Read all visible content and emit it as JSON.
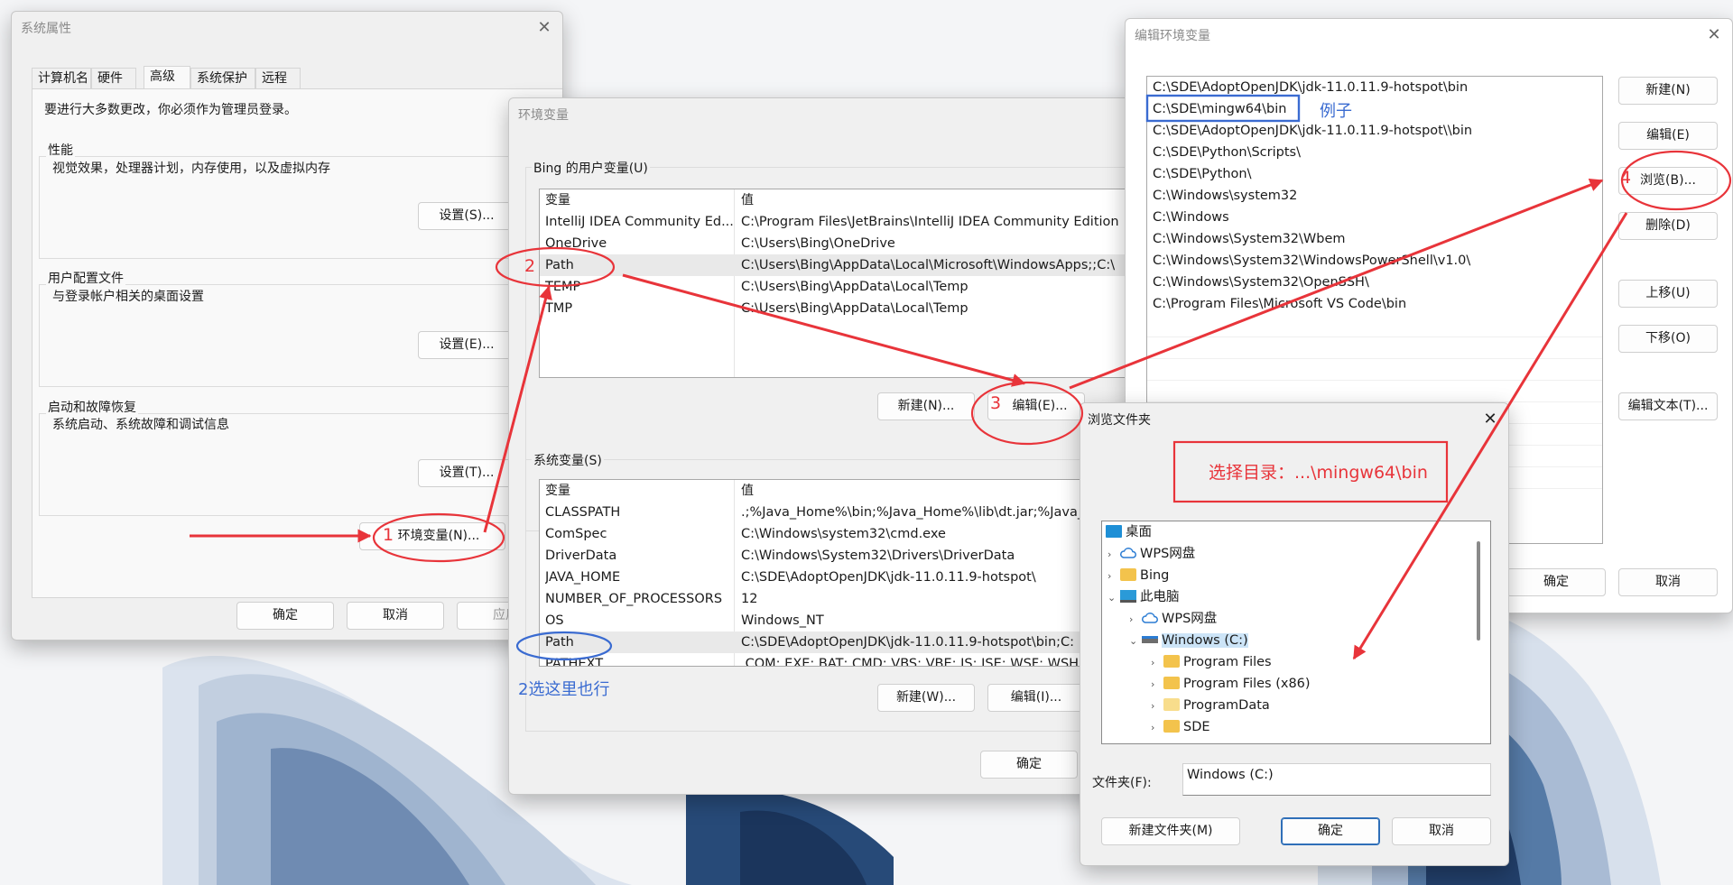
{
  "colors": {
    "annotation_red": "#e8343a",
    "annotation_blue": "#3a6bd1",
    "selection": "#cce4f7",
    "wallpaper_dark": "#1f3a5c"
  },
  "system_properties": {
    "title": "系统属性",
    "tabs": [
      "计算机名",
      "硬件",
      "高级",
      "系统保护",
      "远程"
    ],
    "admin_note": "要进行大多数更改，你必须作为管理员登录。",
    "performance": {
      "label": "性能",
      "description": "视觉效果，处理器计划，内存使用，以及虚拟内存",
      "button": "设置(S)..."
    },
    "profiles": {
      "label": "用户配置文件",
      "description": "与登录帐户相关的桌面设置",
      "button": "设置(E)..."
    },
    "startup": {
      "label": "启动和故障恢复",
      "description": "系统启动、系统故障和调试信息",
      "button": "设置(T)..."
    },
    "env_button": "环境变量(N)...",
    "ok": "确定",
    "cancel": "取消",
    "apply": "应用"
  },
  "env_vars": {
    "title": "环境变量",
    "user_group_label": "Bing 的用户变量(U)",
    "col_var": "变量",
    "col_val": "值",
    "user_rows": [
      {
        "name": "IntelliJ IDEA Community Ed...",
        "value": "C:\\Program Files\\JetBrains\\IntelliJ IDEA Community Edition"
      },
      {
        "name": "OneDrive",
        "value": "C:\\Users\\Bing\\OneDrive"
      },
      {
        "name": "Path",
        "value": "C:\\Users\\Bing\\AppData\\Local\\Microsoft\\WindowsApps;;C:\\"
      },
      {
        "name": "TEMP",
        "value": "C:\\Users\\Bing\\AppData\\Local\\Temp"
      },
      {
        "name": "TMP",
        "value": "C:\\Users\\Bing\\AppData\\Local\\Temp"
      }
    ],
    "user_new": "新建(N)...",
    "user_edit": "编辑(E)...",
    "system_group_label": "系统变量(S)",
    "system_rows": [
      {
        "name": "CLASSPATH",
        "value": ".;%Java_Home%\\bin;%Java_Home%\\lib\\dt.jar;%Java_"
      },
      {
        "name": "ComSpec",
        "value": "C:\\Windows\\system32\\cmd.exe"
      },
      {
        "name": "DriverData",
        "value": "C:\\Windows\\System32\\Drivers\\DriverData"
      },
      {
        "name": "JAVA_HOME",
        "value": "C:\\SDE\\AdoptOpenJDK\\jdk-11.0.11.9-hotspot\\"
      },
      {
        "name": "NUMBER_OF_PROCESSORS",
        "value": "12"
      },
      {
        "name": "OS",
        "value": "Windows_NT"
      },
      {
        "name": "Path",
        "value": "C:\\SDE\\AdoptOpenJDK\\jdk-11.0.11.9-hotspot\\bin;C:"
      },
      {
        "name": "PATHEXT",
        "value": ".COM;.EXE;.BAT;.CMD;.VBS;.VBE;.JS;.JSE;.WSF;.WSH"
      }
    ],
    "system_new": "新建(W)...",
    "system_edit": "编辑(I)...",
    "ok": "确定"
  },
  "edit_env": {
    "title": "编辑环境变量",
    "paths": [
      "C:\\SDE\\AdoptOpenJDK\\jdk-11.0.11.9-hotspot\\bin",
      "C:\\SDE\\mingw64\\bin",
      "C:\\SDE\\AdoptOpenJDK\\jdk-11.0.11.9-hotspot\\\\bin",
      "C:\\SDE\\Python\\Scripts\\",
      "C:\\SDE\\Python\\",
      "C:\\Windows\\system32",
      "C:\\Windows",
      "C:\\Windows\\System32\\Wbem",
      "C:\\Windows\\System32\\WindowsPowerShell\\v1.0\\",
      "C:\\Windows\\System32\\OpenSSH\\",
      "C:\\Program Files\\Microsoft VS Code\\bin"
    ],
    "buttons": [
      "新建(N)",
      "编辑(E)",
      "浏览(B)...",
      "删除(D)",
      "上移(U)",
      "下移(O)",
      "编辑文本(T)..."
    ],
    "ok": "确定",
    "cancel": "取消"
  },
  "browse": {
    "title": "浏览文件夹",
    "tree": [
      {
        "label": "桌面",
        "level": 0,
        "chevron": "",
        "icon": "desktop-icon"
      },
      {
        "label": "WPS网盘",
        "level": 1,
        "chevron": "›",
        "icon": "cloud-icon"
      },
      {
        "label": "Bing",
        "level": 1,
        "chevron": "›",
        "icon": "folder-icon"
      },
      {
        "label": "此电脑",
        "level": 1,
        "chevron": "⌄",
        "icon": "computer-icon"
      },
      {
        "label": "WPS网盘",
        "level": 2,
        "chevron": "›",
        "icon": "cloud-icon"
      },
      {
        "label": "Windows (C:)",
        "level": 2,
        "chevron": "⌄",
        "icon": "drive-icon"
      },
      {
        "label": "Program Files",
        "level": 3,
        "chevron": "›",
        "icon": "folder-icon"
      },
      {
        "label": "Program Files (x86)",
        "level": 3,
        "chevron": "›",
        "icon": "folder-icon"
      },
      {
        "label": "ProgramData",
        "level": 3,
        "chevron": "›",
        "icon": "folder-icon"
      },
      {
        "label": "SDE",
        "level": 3,
        "chevron": "›",
        "icon": "folder-icon"
      }
    ],
    "folder_label": "文件夹(F):",
    "folder_value": "Windows (C:)",
    "new_folder": "新建文件夹(M)",
    "ok": "确定",
    "cancel": "取消"
  },
  "annotations": {
    "step1": "1",
    "step2": "2",
    "step3": "3",
    "step4": "4",
    "example": "例子",
    "alt_hint": "2选这里也行",
    "choose_dir": "选择目录：...\\mingw64\\bin"
  }
}
